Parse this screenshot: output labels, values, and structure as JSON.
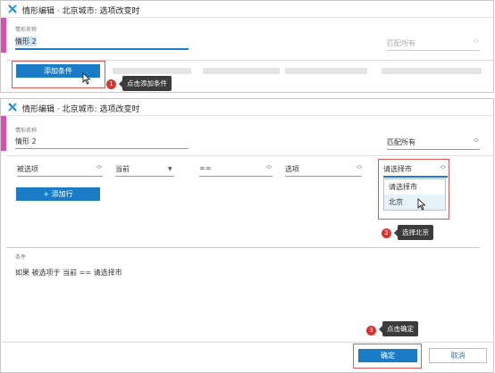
{
  "panel1": {
    "title": "情形编辑 · 北京城市: 选项改变时",
    "name_label": "情形名称",
    "name_value": "情形 2",
    "match_value": "匹配所有",
    "add_condition_button": "添加条件",
    "step_badge": "1",
    "tooltip": "点击添加条件"
  },
  "panel2": {
    "title": "情形编辑 · 北京城市: 选项改变时",
    "name_label": "情形名称",
    "name_value": "情形 2",
    "match_value": "匹配所有",
    "row": {
      "field": "被选项",
      "scope": "当前",
      "operator": "==",
      "value_type": "选项",
      "value": "请选择市"
    },
    "dropdown_options": [
      "请选择市",
      "北京"
    ],
    "add_row_button": "+ 添加行",
    "step2_badge": "2",
    "tooltip2": "选择北京",
    "condition_label": "条件",
    "condition_text": "如果  被选项于 当前 == 请选择市",
    "step3_badge": "3",
    "tooltip3": "点击确定",
    "ok_button": "确定",
    "cancel_button": "取消"
  },
  "colors": {
    "accent": "#d84fb1",
    "primary": "#1a7bc6",
    "highlight": "#e05555",
    "tooltip_bg": "#3b3b3b"
  }
}
